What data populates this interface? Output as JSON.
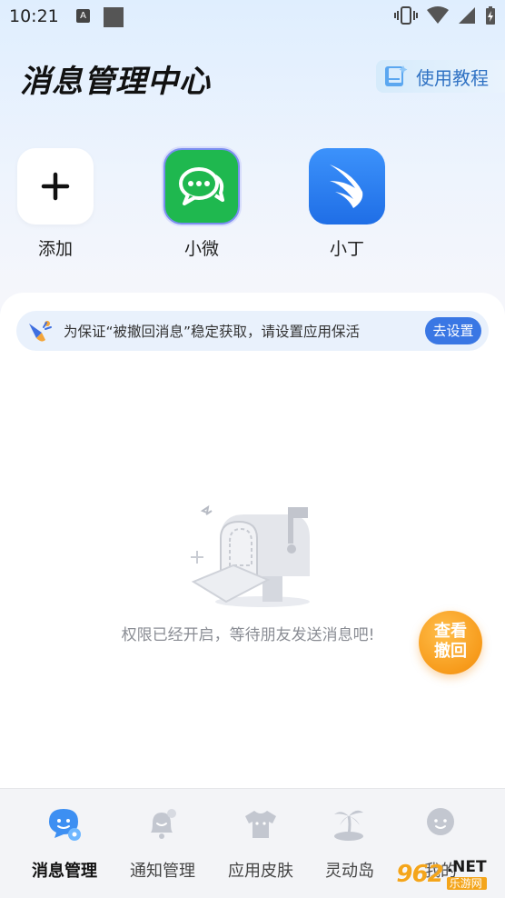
{
  "status_bar": {
    "time": "10:21",
    "notif_letter": "A"
  },
  "header": {
    "title": "消息管理中心",
    "tutorial_label": "使用教程"
  },
  "apps": [
    {
      "label": "添加",
      "icon": "plus-icon"
    },
    {
      "label": "小微",
      "icon": "wechat-chat-icon"
    },
    {
      "label": "小丁",
      "icon": "dingtalk-wing-icon"
    }
  ],
  "notice": {
    "text": "为保证“被撤回消息”稳定获取，请设置应用保活",
    "button_label": "去设置",
    "icon": "megaphone-icon"
  },
  "empty_state": {
    "message": "权限已经开启，等待朋友发送消息吧!",
    "icon": "mailbox-illustration"
  },
  "fab": {
    "label": "查看\n撤回"
  },
  "nav": [
    {
      "label": "消息管理",
      "icon": "message-manage-icon",
      "active": true
    },
    {
      "label": "通知管理",
      "icon": "notification-bell-icon",
      "active": false
    },
    {
      "label": "应用皮肤",
      "icon": "tshirt-skin-icon",
      "active": false
    },
    {
      "label": "灵动岛",
      "icon": "island-palm-icon",
      "active": false
    },
    {
      "label": "我的",
      "icon": "profile-avatar-icon",
      "active": false
    }
  ],
  "watermark": {
    "logo": "962",
    "net": ".NET",
    "sub": "乐游网"
  },
  "colors": {
    "accent": "#3a77e4",
    "wechat_green": "#1fb84f",
    "ding_blue": "#2f7ff0",
    "fab_orange": "#f79b1b"
  }
}
